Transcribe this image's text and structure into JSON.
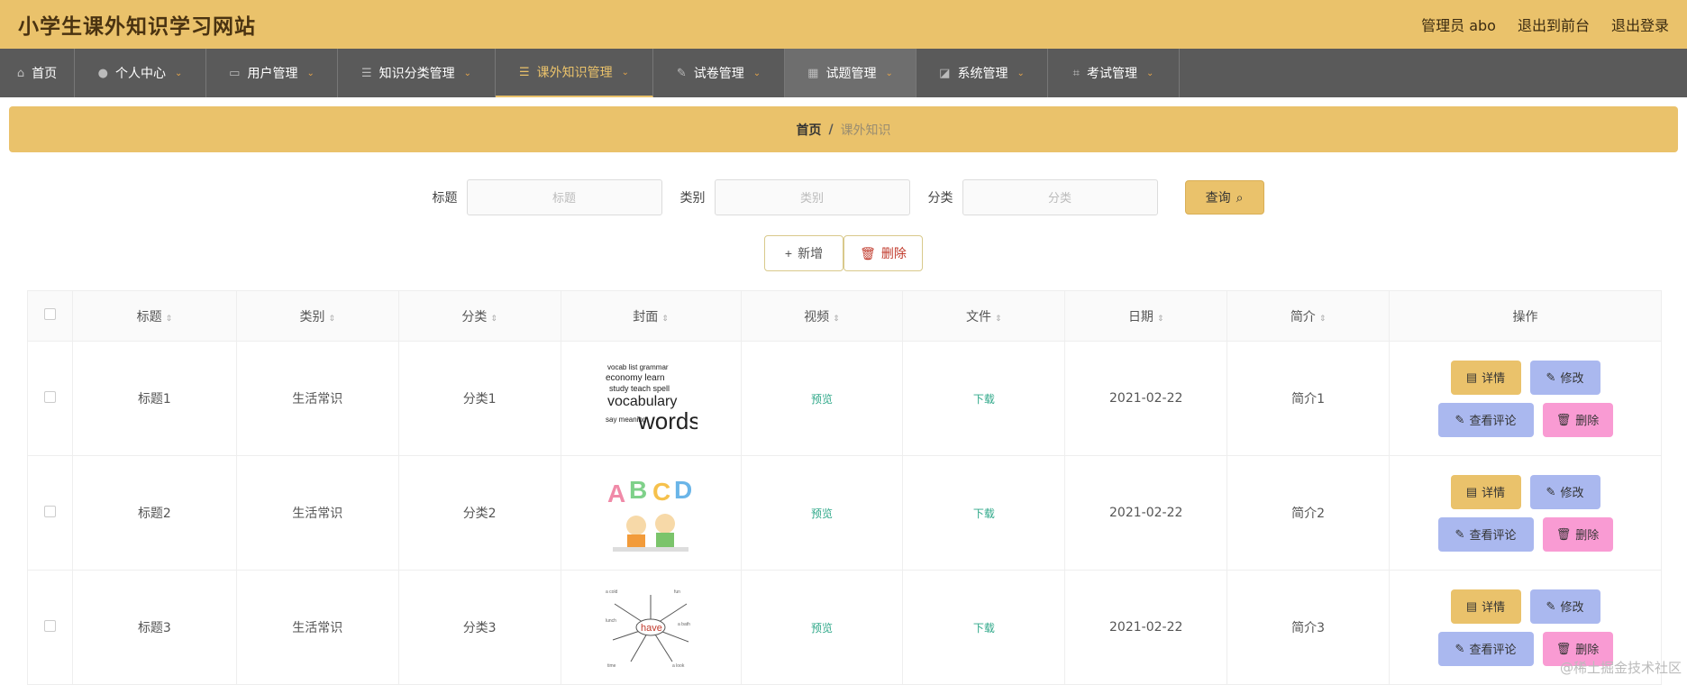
{
  "header": {
    "title": "小学生课外知识学习网站",
    "admin_label": "管理员 abo",
    "front_link": "退出到前台",
    "logout_link": "退出登录",
    "bg_color": "#eac26b"
  },
  "nav": {
    "items": [
      {
        "label": "首页",
        "icon": "home-icon",
        "glyph": "⌂",
        "dropdown": false
      },
      {
        "label": "个人中心",
        "icon": "user-icon",
        "glyph": "👤",
        "dropdown": true
      },
      {
        "label": "用户管理",
        "icon": "users-icon",
        "glyph": "▭",
        "dropdown": true
      },
      {
        "label": "知识分类管理",
        "icon": "list-icon",
        "glyph": "☰",
        "dropdown": true
      },
      {
        "label": "课外知识管理",
        "icon": "menu-icon",
        "glyph": "☰",
        "dropdown": true,
        "active": true
      },
      {
        "label": "试卷管理",
        "icon": "paper-icon",
        "glyph": "✎",
        "dropdown": true
      },
      {
        "label": "试题管理",
        "icon": "grid-icon",
        "glyph": "▦",
        "dropdown": true
      },
      {
        "label": "系统管理",
        "icon": "chart-icon",
        "glyph": "◪",
        "dropdown": true
      },
      {
        "label": "考试管理",
        "icon": "crop-icon",
        "glyph": "⌗",
        "dropdown": true
      }
    ],
    "active_color": "#eac26b"
  },
  "breadcrumb": {
    "home": "首页",
    "separator": "/",
    "current": "课外知识"
  },
  "search": {
    "title_label": "标题",
    "title_placeholder": "标题",
    "category_label": "类别",
    "category_placeholder": "类别",
    "class_label": "分类",
    "class_placeholder": "分类",
    "query_button": "查询"
  },
  "actions": {
    "add": "新增",
    "delete": "删除"
  },
  "table": {
    "columns": [
      "标题",
      "类别",
      "分类",
      "封面",
      "视频",
      "文件",
      "日期",
      "简介",
      "操作"
    ],
    "rows": [
      {
        "title": "标题1",
        "category": "生活常识",
        "class": "分类1",
        "cover": "words-cover",
        "video": "预览",
        "file": "下载",
        "date": "2021-02-22",
        "intro": "简介1"
      },
      {
        "title": "标题2",
        "category": "生活常识",
        "class": "分类2",
        "cover": "abcd-cover",
        "video": "预览",
        "file": "下载",
        "date": "2021-02-22",
        "intro": "简介2"
      },
      {
        "title": "标题3",
        "category": "生活常识",
        "class": "分类3",
        "cover": "have-cover",
        "video": "预览",
        "file": "下载",
        "date": "2021-02-22",
        "intro": "简介3"
      }
    ],
    "row_ops": {
      "detail": "详情",
      "edit": "修改",
      "comment": "查看评论",
      "delete": "删除"
    }
  },
  "watermark": "@稀土掘金技术社区"
}
